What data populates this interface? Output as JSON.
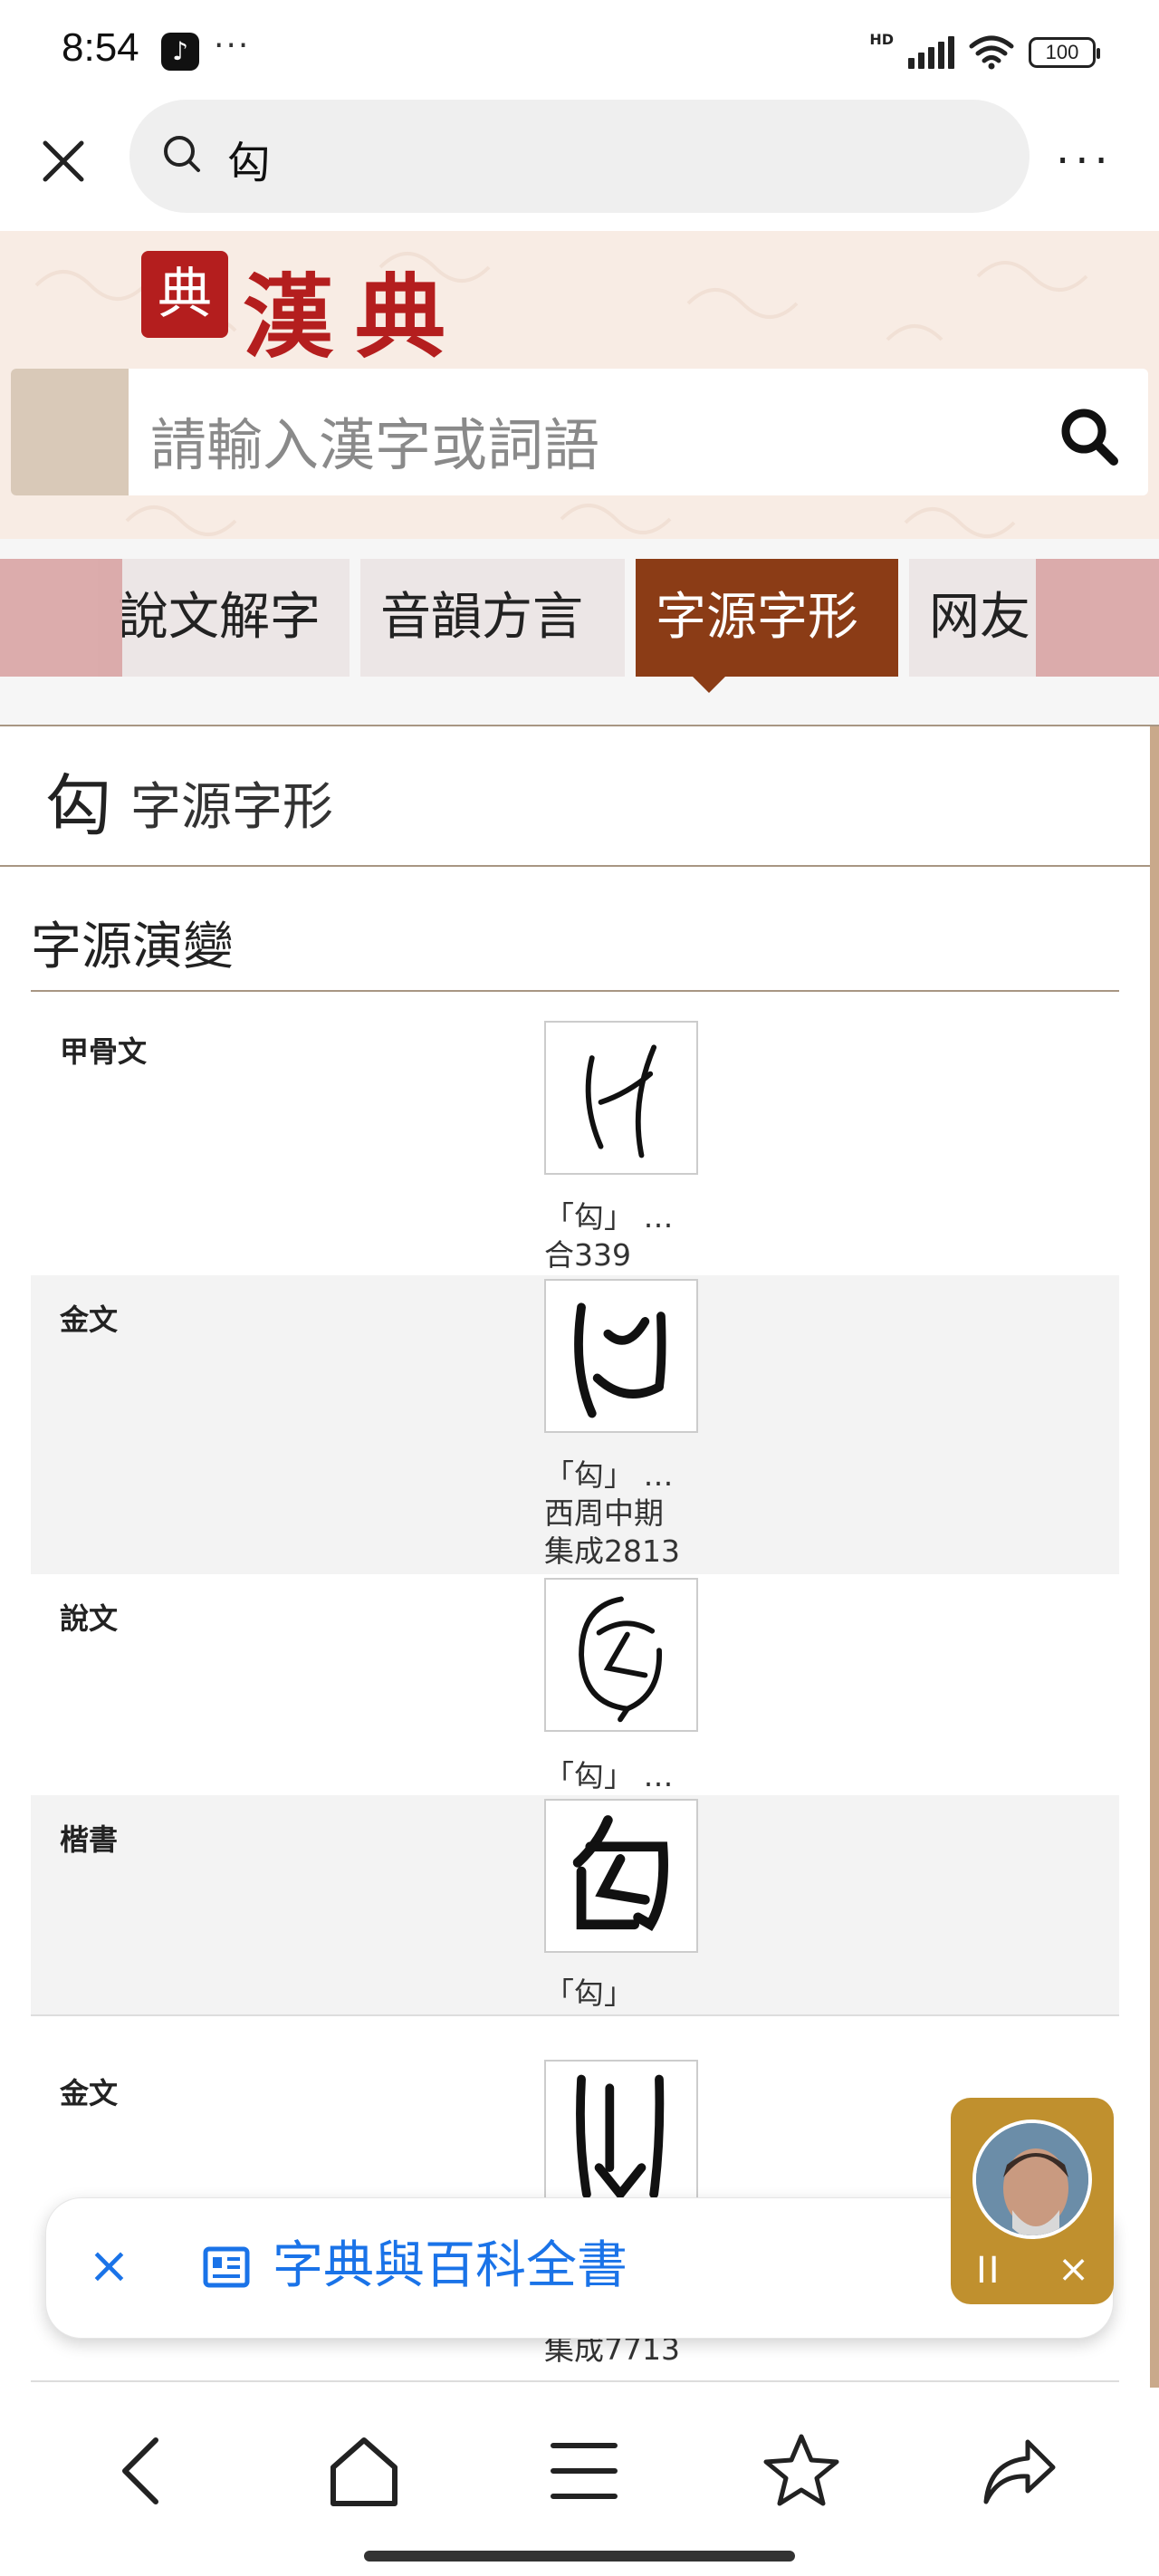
{
  "status_bar": {
    "time": "8:54",
    "dots": "···",
    "network": "HD",
    "battery": "100",
    "icons": [
      "tiktok-icon",
      "signal-icon",
      "wifi-icon",
      "battery-icon"
    ]
  },
  "browser": {
    "search_query": "匃",
    "more_label": "···"
  },
  "site": {
    "seal": "典",
    "logo": "漢典",
    "search_placeholder": "請輸入漢字或詞語"
  },
  "tabs": [
    {
      "label": "說文解字",
      "active": false
    },
    {
      "label": "音韻方言",
      "active": false
    },
    {
      "label": "字源字形",
      "active": true
    },
    {
      "label": "网友",
      "active": false
    }
  ],
  "card": {
    "char": "匃",
    "title": "字源字形",
    "section_title": "字源演變"
  },
  "rows": [
    {
      "label": "甲骨文",
      "cap1": "「匃」 …",
      "cap2": "合339",
      "cap3": ""
    },
    {
      "label": "金文",
      "cap1": "「匃」 …",
      "cap2": "西周中期",
      "cap3": "集成2813"
    },
    {
      "label": "說文",
      "cap1": "「匃」 …",
      "cap2": "",
      "cap3": ""
    },
    {
      "label": "楷書",
      "cap1": "「匃」",
      "cap2": "",
      "cap3": ""
    },
    {
      "label": "金文",
      "cap1": "",
      "cap2": "",
      "cap3": ""
    }
  ],
  "partial_caption": "集成7713",
  "toast": {
    "close": "×",
    "text": "字典與百科全書"
  },
  "media": {
    "pause": "II",
    "close": "×"
  },
  "colors": {
    "brand_red": "#b41e1e",
    "tab_active": "#8b3c16",
    "link_blue": "#1a73e8",
    "media_gold": "#c0902e"
  }
}
